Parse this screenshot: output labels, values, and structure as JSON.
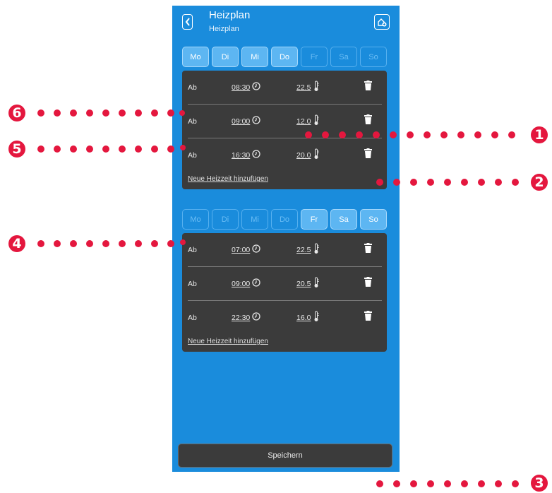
{
  "header": {
    "title": "Heizplan",
    "subtitle": "Heizplan"
  },
  "icons": {
    "back": "chevron-left-icon",
    "home": "home-plus-icon",
    "clock": "clock-icon",
    "thermometer": "thermometer-icon",
    "trash": "trash-icon"
  },
  "groups": [
    {
      "days": [
        {
          "label": "Mo",
          "active": true
        },
        {
          "label": "Di",
          "active": true
        },
        {
          "label": "Mi",
          "active": true
        },
        {
          "label": "Do",
          "active": true
        },
        {
          "label": "Fr",
          "active": false
        },
        {
          "label": "Sa",
          "active": false
        },
        {
          "label": "So",
          "active": false
        }
      ],
      "rows": [
        {
          "prefix": "Ab",
          "time": "08:30",
          "temp": "22.5"
        },
        {
          "prefix": "Ab",
          "time": "09:00",
          "temp": "12.0"
        },
        {
          "prefix": "Ab",
          "time": "16:30",
          "temp": "20.0"
        }
      ],
      "add_label": "Neue Heizzeit hinzufügen"
    },
    {
      "days": [
        {
          "label": "Mo",
          "active": false
        },
        {
          "label": "Di",
          "active": false
        },
        {
          "label": "Mi",
          "active": false
        },
        {
          "label": "Do",
          "active": false
        },
        {
          "label": "Fr",
          "active": true
        },
        {
          "label": "Sa",
          "active": true
        },
        {
          "label": "So",
          "active": true
        }
      ],
      "rows": [
        {
          "prefix": "Ab",
          "time": "07:00",
          "temp": "22.5"
        },
        {
          "prefix": "Ab",
          "time": "09:00",
          "temp": "20.5"
        },
        {
          "prefix": "Ab",
          "time": "22:30",
          "temp": "16.0"
        }
      ],
      "add_label": "Neue Heizzeit hinzufügen"
    }
  ],
  "save_label": "Speichern",
  "callouts": [
    "1",
    "2",
    "3",
    "4",
    "5",
    "6"
  ],
  "colors": {
    "app_bg": "#1a8cdc",
    "card_bg": "#3b3b3b",
    "day_active": "#5db6f2",
    "callout": "#e4173e"
  }
}
